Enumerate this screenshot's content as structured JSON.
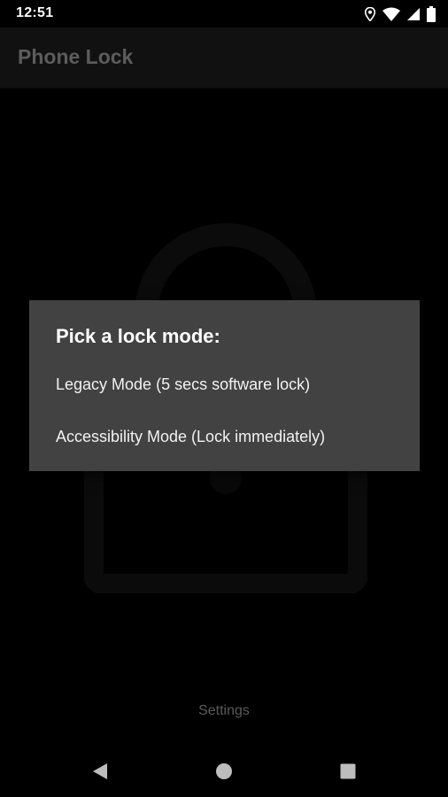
{
  "status_bar": {
    "time": "12:51",
    "icons": [
      "location-icon",
      "wifi-icon",
      "signal-icon",
      "battery-icon"
    ]
  },
  "app_bar": {
    "title": "Phone Lock"
  },
  "dialog": {
    "title": "Pick a lock mode:",
    "options": [
      {
        "label": "Legacy Mode (5 secs software lock)"
      },
      {
        "label": "Accessibility Mode (Lock immediately)"
      }
    ]
  },
  "footer": {
    "settings_label": "Settings"
  },
  "nav_bar": {
    "buttons": [
      "back-icon",
      "home-icon",
      "recents-icon"
    ]
  },
  "colors": {
    "background": "#000000",
    "app_bar": "#111111",
    "dialog": "#424242",
    "title_text": "#5c5c5c",
    "dialog_text": "#ffffff",
    "settings_text": "#5a5a5a"
  }
}
